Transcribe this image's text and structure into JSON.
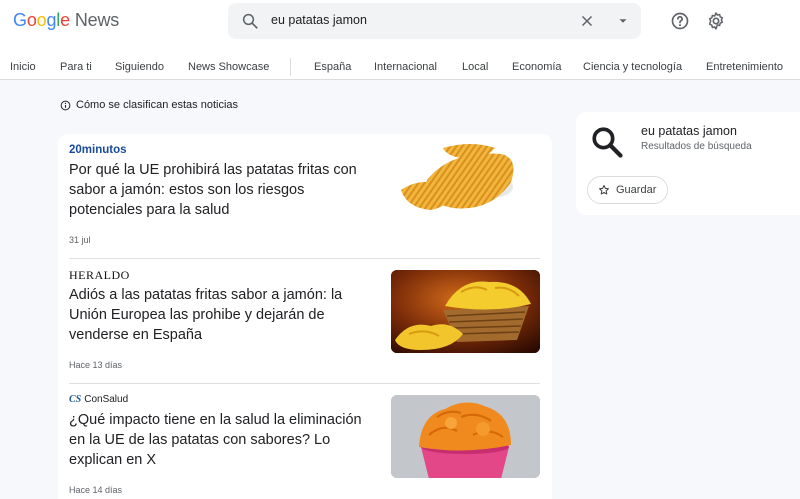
{
  "header": {
    "logo_parts": [
      "G",
      "o",
      "o",
      "g",
      "l",
      "e"
    ],
    "logo_suffix": "News",
    "search_query": "eu patatas jamon"
  },
  "nav": {
    "items": [
      "Inicio",
      "Para ti",
      "Siguiendo",
      "News Showcase",
      "España",
      "Internacional",
      "Local",
      "Economía",
      "Ciencia y tecnología",
      "Entretenimiento"
    ]
  },
  "info_line": "Cómo se clasifican estas noticias",
  "articles": [
    {
      "source": "20minutos",
      "title": "Por qué la UE prohibirá las patatas fritas con sabor a jamón: estos son los riesgos potenciales para la salud",
      "date": "31 jul"
    },
    {
      "source": "HERALDO",
      "title": "Adiós a las patatas fritas sabor a jamón: la Unión Europea las prohibe y dejarán de venderse en España",
      "date": "Hace 13 días"
    },
    {
      "source": "ConSalud",
      "source_mark": "CS",
      "title": "¿Qué impacto tiene en la salud la eliminación en la UE de las patatas con sabores? Lo explican en X",
      "date": "Hace 14 días"
    }
  ],
  "sidebar": {
    "query": "eu patatas jamon",
    "subtitle": "Resultados de búsqueda",
    "save_label": "Guardar"
  },
  "colors": {
    "accent_blue": "#1a73e8",
    "brand_20minutos": "#1a4b9c",
    "brand_consalud": "#1d5a99"
  }
}
